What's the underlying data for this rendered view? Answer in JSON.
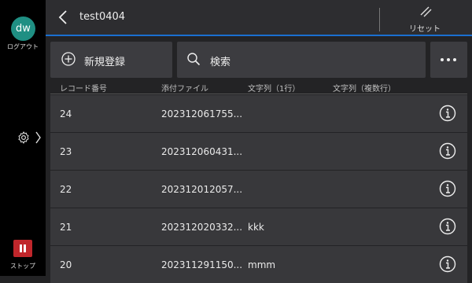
{
  "rail": {
    "avatar_text": "dw",
    "logout_label": "ログアウト",
    "stop_label": "ストップ",
    "stop_color": "#c0262b",
    "avatar_color": "#1f8f83"
  },
  "header": {
    "title": "test0404",
    "reset_label": "リセット",
    "accent_color": "#1a6fd0"
  },
  "toolbar": {
    "new_label": "新規登録",
    "search_label": "検索"
  },
  "table": {
    "columns": [
      "レコード番号",
      "添付ファイル",
      "文字列（1行）",
      "文字列（複数行）"
    ],
    "rows": [
      {
        "id": "24",
        "file": "202312061755...",
        "text": ""
      },
      {
        "id": "23",
        "file": "202312060431...",
        "text": ""
      },
      {
        "id": "22",
        "file": "202312012057...",
        "text": ""
      },
      {
        "id": "21",
        "file": "202312020332...",
        "text": "kkk"
      },
      {
        "id": "20",
        "file": "202311291150...",
        "text": "mmm"
      }
    ]
  }
}
